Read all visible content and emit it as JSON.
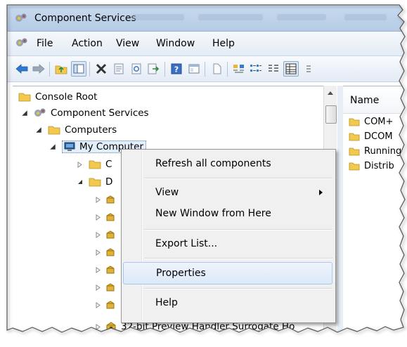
{
  "window": {
    "title": "Component Services"
  },
  "menubar": {
    "items": [
      "File",
      "Action",
      "View",
      "Window",
      "Help"
    ]
  },
  "toolbar": {
    "buttons": [
      "back-icon",
      "forward-icon",
      "up-folder-icon",
      "show-hide-tree-icon",
      "delete-icon",
      "properties-icon",
      "refresh-icon",
      "export-icon",
      "help-icon",
      "console-tree-icon",
      "new-window-icon",
      "large-icons-icon",
      "small-icons-icon",
      "list-view-icon",
      "detail-view-icon"
    ]
  },
  "tree": {
    "console_root": "Console Root",
    "component_services": "Component Services",
    "computers": "Computers",
    "my_computer": "My Computer",
    "child_c": "C",
    "child_d": "D",
    "last_item": "32-bit Preview Handler Surrogate Ho"
  },
  "list": {
    "header": "Name",
    "items": [
      "COM+",
      "DCOM",
      "Running",
      "Distrib"
    ]
  },
  "context_menu": {
    "refresh": "Refresh all components",
    "view": "View",
    "new_window": "New Window from Here",
    "export": "Export List...",
    "properties": "Properties",
    "help": "Help"
  },
  "colors": {
    "highlight_border": "#a8c8eb",
    "folder": "#f2c94c",
    "titlebar": "#c8daef"
  }
}
